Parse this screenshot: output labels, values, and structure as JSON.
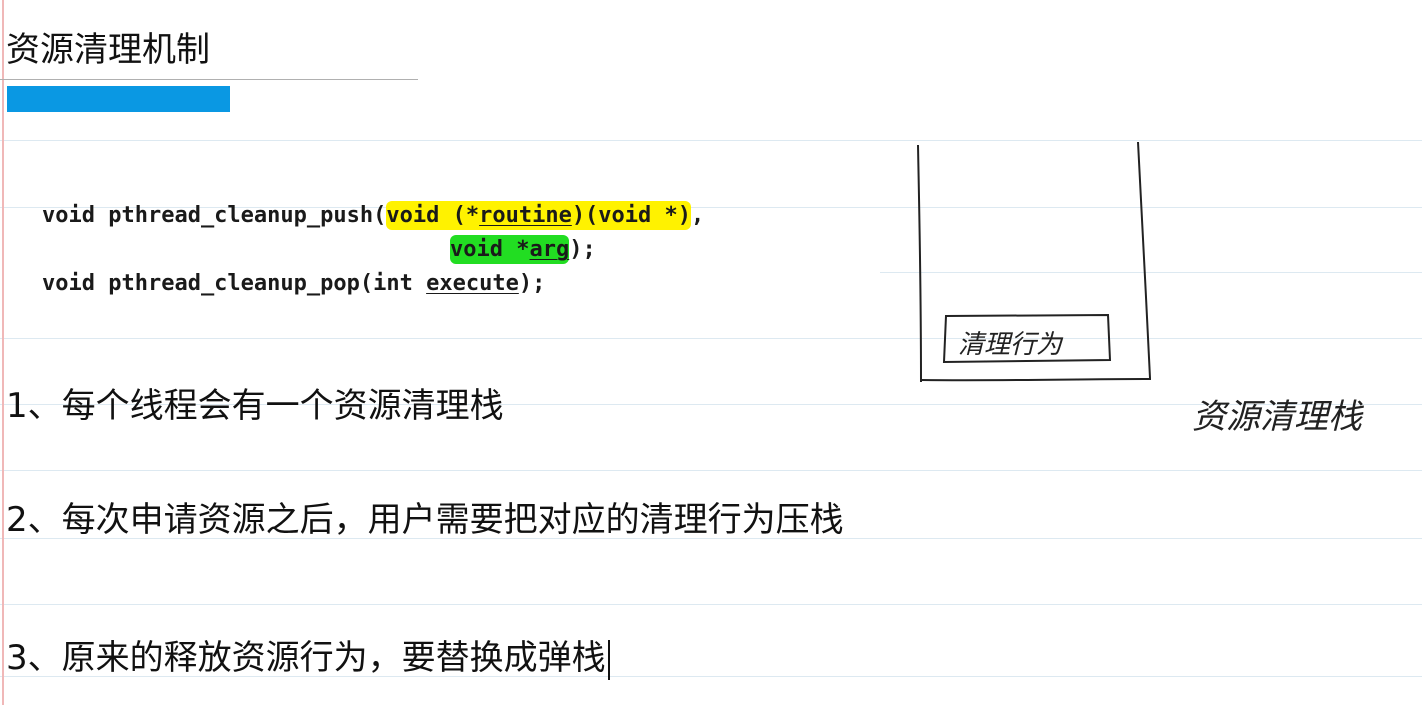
{
  "page_title": "资源清理机制",
  "code": {
    "line1_prefix": "void pthread_cleanup_push(",
    "line1_hl_a": "void (*",
    "line1_hl_routine": "routine",
    "line1_hl_b": ")(void *)",
    "line1_suffix": ",",
    "line2_hl_a": "void *",
    "line2_hl_arg": "arg",
    "line2_suffix": ");",
    "line3_prefix": "void pthread_cleanup_pop(int ",
    "line3_execute": "execute",
    "line3_suffix": ");"
  },
  "points": [
    "1、每个线程会有一个资源清理栈",
    "2、每次申请资源之后，用户需要把对应的清理行为压栈",
    "3、原来的释放资源行为，要替换成弹栈"
  ],
  "sketch": {
    "box_label": "清理行为",
    "stack_label": "资源清理栈"
  },
  "colors": {
    "accent_bar": "#0a98e3",
    "highlight_yellow": "#fff200",
    "highlight_green": "#22dd22",
    "ruled_line": "#dde9f1",
    "margin_line": "#f0b8b8"
  }
}
